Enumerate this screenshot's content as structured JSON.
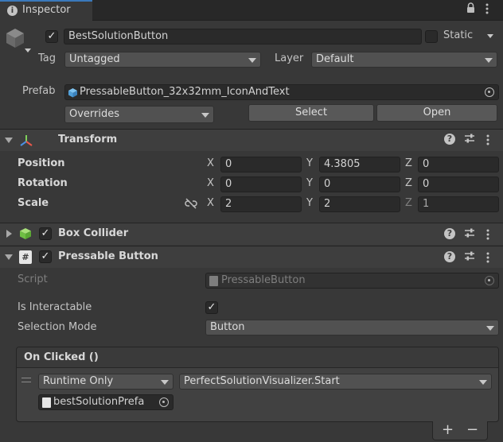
{
  "tab": {
    "title": "Inspector",
    "lock_icon": "lock-icon",
    "menu_icon": "kebab-icon"
  },
  "object": {
    "active": true,
    "name": "BestSolutionButton",
    "static_label": "Static",
    "static_checked": false,
    "tag_label": "Tag",
    "tag_value": "Untagged",
    "layer_label": "Layer",
    "layer_value": "Default",
    "prefab_label": "Prefab",
    "prefab_value": "PressableButton_32x32mm_IconAndText",
    "overrides_value": "Overrides",
    "select_label": "Select",
    "open_label": "Open"
  },
  "transform": {
    "title": "Transform",
    "position_label": "Position",
    "rotation_label": "Rotation",
    "scale_label": "Scale",
    "x_label": "X",
    "y_label": "Y",
    "z_label": "Z",
    "position": {
      "x": "0",
      "y": "4.3805",
      "z": "0"
    },
    "rotation": {
      "x": "0",
      "y": "0",
      "z": "0"
    },
    "scale": {
      "x": "2",
      "y": "2",
      "z": "1"
    }
  },
  "box_collider": {
    "title": "Box Collider",
    "enabled": true
  },
  "pressable_button": {
    "title": "Pressable Button",
    "enabled": true,
    "script_label": "Script",
    "script_value": "PressableButton",
    "interactable_label": "Is Interactable",
    "interactable_checked": true,
    "selection_mode_label": "Selection Mode",
    "selection_mode_value": "Button",
    "event_title": "On Clicked ()",
    "runtime_value": "Runtime Only",
    "function_value": "PerfectSolutionVisualizer.Start",
    "target_value": "bestSolutionPrefa",
    "add_label": "+",
    "remove_label": "−"
  },
  "colors": {
    "panel": "#383838",
    "field": "#2a2a2a",
    "header": "#3e3e3e",
    "tab_bg": "#282828"
  }
}
